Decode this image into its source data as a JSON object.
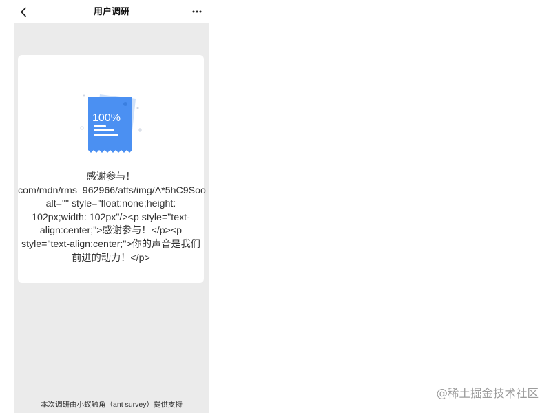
{
  "header": {
    "title": "用户调研",
    "back_icon": "chevron-left-icon",
    "more_icon": "more-horizontal-icon"
  },
  "card": {
    "illustration": {
      "icon": "survey-complete-document-icon",
      "label": "100%"
    },
    "message_lines": [
      "感谢参与！",
      "com/mdn/rms_962966/afts/img/A*5hC9Soo",
      "alt=\"\" style=\"float:none;height:",
      "102px;width: 102px\"/><p style=\"text-",
      "align:center;\">感谢参与！</p><p",
      "style=\"text-align:center;\">你的声音是我们",
      "前进的动力！</p>"
    ]
  },
  "footer": {
    "text": "本次调研由小蚁触角（ant survey）提供支持"
  },
  "watermark": {
    "text": "@稀土掘金技术社区"
  },
  "colors": {
    "page_bg": "#ffffff",
    "content_bg": "#ebebeb",
    "card_bg": "#ffffff",
    "text": "#333333",
    "accent_blue": "#4b90f2",
    "sheet_blue": "#cfe1fa"
  }
}
